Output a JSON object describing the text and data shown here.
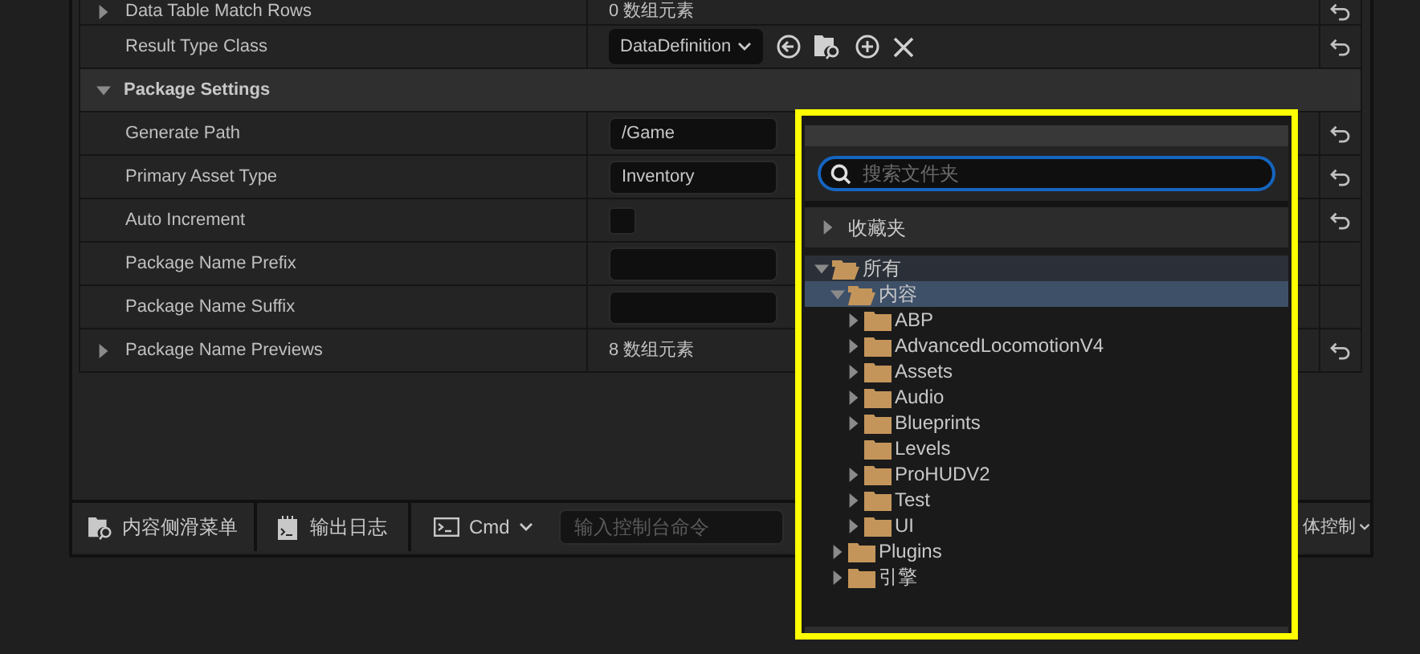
{
  "rows": [
    {
      "kind": "array",
      "label": "Data Table Match Rows",
      "value": "0 数组元素",
      "expanded": false,
      "resettable": true
    },
    {
      "kind": "class",
      "label": "Result Type Class",
      "value": "DataDefinition",
      "resettable": true
    },
    {
      "kind": "category",
      "label": "Package Settings",
      "expanded": true
    },
    {
      "kind": "text",
      "label": "Generate Path",
      "value": "/Game",
      "resettable": true
    },
    {
      "kind": "text",
      "label": "Primary Asset Type",
      "value": "Inventory",
      "resettable": true
    },
    {
      "kind": "checkbox",
      "label": "Auto Increment",
      "checked": false,
      "resettable": true
    },
    {
      "kind": "text",
      "label": "Package Name Prefix",
      "resettable": false
    },
    {
      "kind": "text",
      "label": "Package Name Suffix",
      "resettable": false
    },
    {
      "kind": "array",
      "label": "Package Name Previews",
      "value": "8 数组元素",
      "expanded": false,
      "resettable": true
    }
  ],
  "bottom_bar": {
    "content_drawer": "内容侧滑菜单",
    "output_log": "输出日志",
    "cmd": "Cmd",
    "console": {
      "placeholder": "输入控制台命令"
    },
    "right_label": "体控制"
  },
  "folder_picker": {
    "search": {
      "placeholder": "搜索文件夹"
    },
    "favorites": {
      "label": "收藏夹",
      "expanded": false
    },
    "tree": [
      {
        "label": "所有",
        "expanded": true,
        "selected": false,
        "children": [
          {
            "label": "内容",
            "expanded": true,
            "selected": true,
            "children": [
              {
                "label": "ABP",
                "expandable": true,
                "selected": false
              },
              {
                "label": "AdvancedLocomotionV4",
                "expandable": true,
                "selected": false
              },
              {
                "label": "Assets",
                "expandable": true,
                "selected": false
              },
              {
                "label": "Audio",
                "expandable": true,
                "selected": false
              },
              {
                "label": "Blueprints",
                "expandable": true,
                "selected": false
              },
              {
                "label": "Levels",
                "expandable": false,
                "selected": false
              },
              {
                "label": "ProHUDV2",
                "expandable": true,
                "selected": false
              },
              {
                "label": "Test",
                "expandable": true,
                "selected": false
              },
              {
                "label": "UI",
                "expandable": true,
                "selected": false
              }
            ]
          },
          {
            "label": "Plugins",
            "expandable": true,
            "selected": false
          },
          {
            "label": "引擎",
            "expandable": true,
            "selected": false
          }
        ]
      }
    ]
  }
}
